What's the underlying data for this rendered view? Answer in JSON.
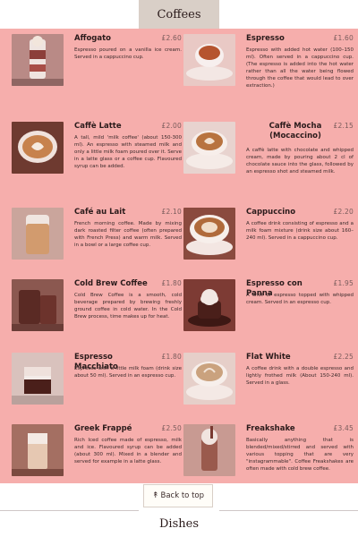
{
  "sections": {
    "coffees_tab": "Coffees",
    "dishes_tab": "Dishes"
  },
  "back_to_top": {
    "icon": "double-chevron-up-icon",
    "label": "Back to top"
  },
  "colors": {
    "menu_background": "#f6aeac",
    "tab_background": "#d9cfc7"
  },
  "items": [
    {
      "name": "Affogato",
      "price": "£2.60",
      "description": "Espresso poured on a vanilla ice cream. Served in a cappuccino cup."
    },
    {
      "name": "Espresso",
      "price": "£1.60",
      "description": "Espresso with added hot water (100–150 ml). Often served in a cappuccino cup. (The espresso is added into the hot water rather than all the water being flowed through the coffee that would lead to over extraction.)"
    },
    {
      "name": "Caffè Latte",
      "price": "£2.00",
      "description": "A tall, mild 'milk coffee' (about 150-300 ml). An espresso with steamed milk and only a little milk foam poured over it. Serve in a latte glass or a coffee cup. Flavoured syrup can be added."
    },
    {
      "name": "Caffè Mocha (Mocaccino)",
      "price": "£2.15",
      "description": "A caffè latte with chocolate and whipped cream, made by pouring about 2 cl of chocolate sauce into the glass, followed by an espresso shot and steamed milk."
    },
    {
      "name": "Café au Lait",
      "price": "£2.10",
      "description": "French morning coffee. Made by mixing dark roasted filter coffee (often prepared with French Press) and warm milk. Served in a bowl or a large coffee cup."
    },
    {
      "name": "Cappuccino",
      "price": "£2.20",
      "description": "A coffee drink consisting of espresso and a milk foam mixture (drink size about 160–240 ml). Served in a cappuccino cup."
    },
    {
      "name": "Cold Brew Coffee",
      "price": "£1.80",
      "description": "Cold Brew Coffee is a smooth, cold beverage prepared by brewing freshly ground coffee in cold water. In the Cold Brew process, time makes up for heat."
    },
    {
      "name": "Espresso con Panna",
      "price": "£1.95",
      "description": "A shot of espresso topped with whipped cream. Served in an espresso cup."
    },
    {
      "name": "Espresso Macchiato",
      "price": "£1.80",
      "description": "Espresso with a little milk foam (drink size about 50 ml). Served in an espresso cup."
    },
    {
      "name": "Flat White",
      "price": "£2.25",
      "description": "A coffee drink with a double espresso and lightly frothed milk (About 150-240 ml). Served in a glass."
    },
    {
      "name": "Greek Frappé",
      "price": "£2.50",
      "description": "Rich Iced coffee made of espresso, milk and ice. Flavoured syrup can be added (about 300 ml). Mixed in a blender and served for example in a latte glass."
    },
    {
      "name": "Freakshake",
      "price": "£3.45",
      "description": "Basically anything that is blended/mixed/stirred and served with various topping that are very \"instagrammable\". Coffee Freakshakes are often made with cold brew coffee."
    }
  ]
}
